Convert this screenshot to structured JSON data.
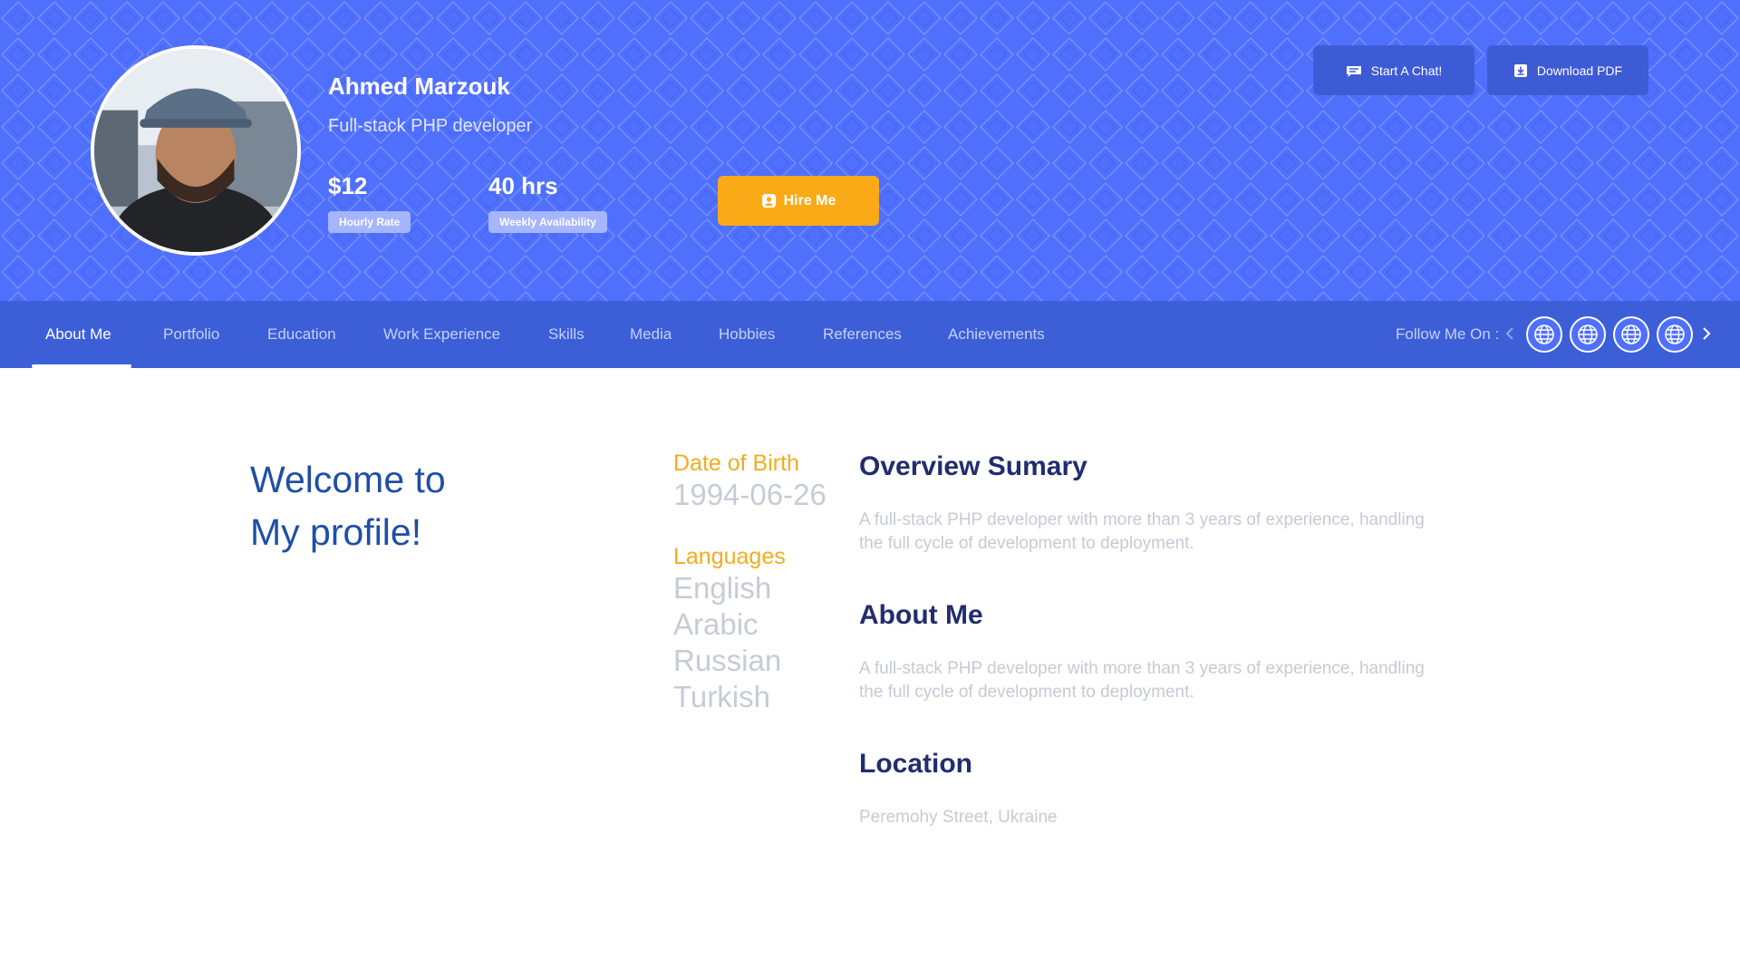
{
  "profile": {
    "name": "Ahmed Marzouk",
    "title": "Full-stack PHP developer",
    "hourly_rate": "$12",
    "hourly_rate_label": "Hourly Rate",
    "availability": "40 hrs",
    "availability_label": "Weekly Availability",
    "hire_label": "Hire Me"
  },
  "actions": {
    "chat_label": "Start A Chat!",
    "pdf_label": "Download PDF"
  },
  "nav": {
    "tabs": [
      {
        "label": "About Me",
        "active": true
      },
      {
        "label": "Portfolio"
      },
      {
        "label": "Education"
      },
      {
        "label": "Work Experience"
      },
      {
        "label": "Skills"
      },
      {
        "label": "Media"
      },
      {
        "label": "Hobbies"
      },
      {
        "label": "References"
      },
      {
        "label": "Achievements"
      }
    ],
    "follow_label": "Follow Me On :",
    "social_icons": [
      "globe-icon",
      "globe-icon",
      "globe-icon",
      "globe-icon"
    ]
  },
  "content": {
    "welcome_line1": "Welcome to",
    "welcome_line2": "My profile!",
    "dob_label": "Date of Birth",
    "dob_value": "1994-06-26",
    "languages_label": "Languages",
    "languages": [
      "English",
      "Arabic",
      "Russian",
      "Turkish"
    ],
    "sections": [
      {
        "title": "Overview Sumary",
        "text": "A full-stack PHP developer with more than 3 years of experience, handling the full cycle of development to deployment."
      },
      {
        "title": "About Me",
        "text": "A full-stack PHP developer with more than 3 years of experience, handling the full cycle of development to deployment."
      },
      {
        "title": "Location",
        "text": "Peremohy Street, Ukraine"
      }
    ]
  },
  "colors": {
    "hero": "#4f6ffd",
    "nav": "#3c5fd8",
    "accent": "#fbaa17",
    "heading": "#222d6e",
    "welcome": "#1f4fa5"
  }
}
